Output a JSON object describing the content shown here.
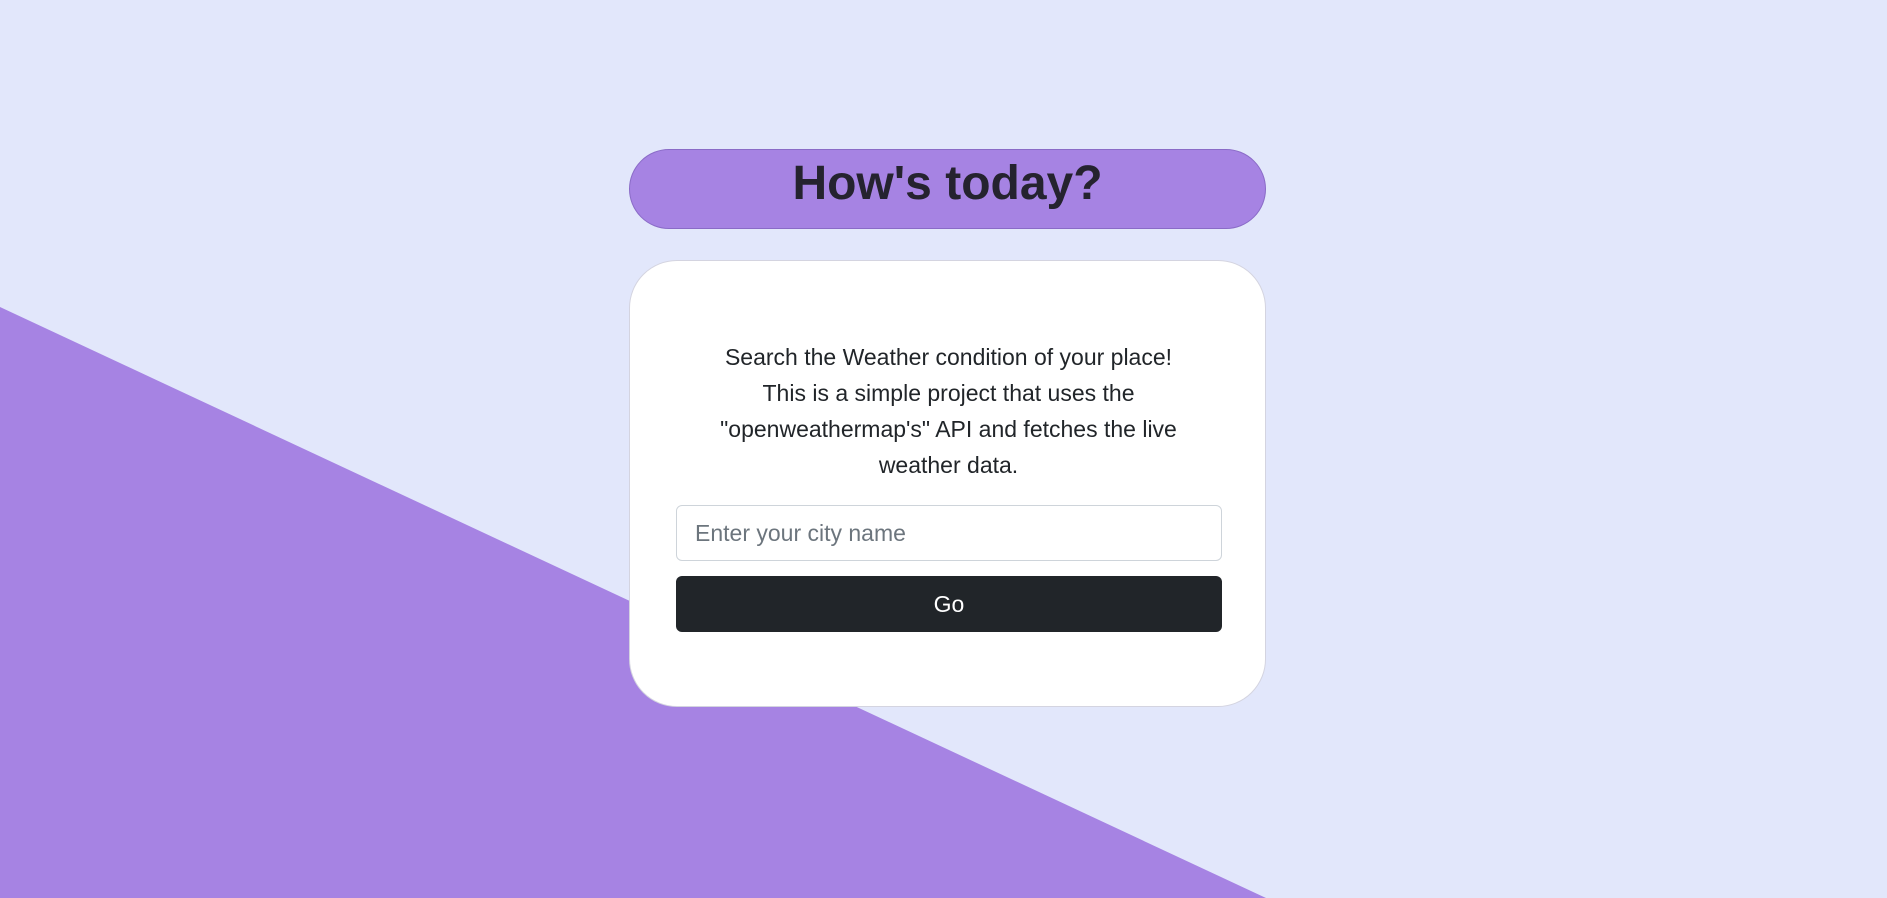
{
  "header": {
    "title": "How's today?"
  },
  "card": {
    "description_lines": [
      "Search the Weather condition of your place!",
      "This is a simple project that uses the",
      "\"openweathermap's\" API and fetches the live",
      "weather data."
    ]
  },
  "search": {
    "value": "",
    "placeholder": "Enter your city name"
  },
  "actions": {
    "go_label": "Go"
  },
  "colors": {
    "background": "#e2e7fb",
    "accent_purple": "#a683e3",
    "card_background": "#ffffff",
    "button_background": "#212529",
    "text_dark": "#212529"
  }
}
